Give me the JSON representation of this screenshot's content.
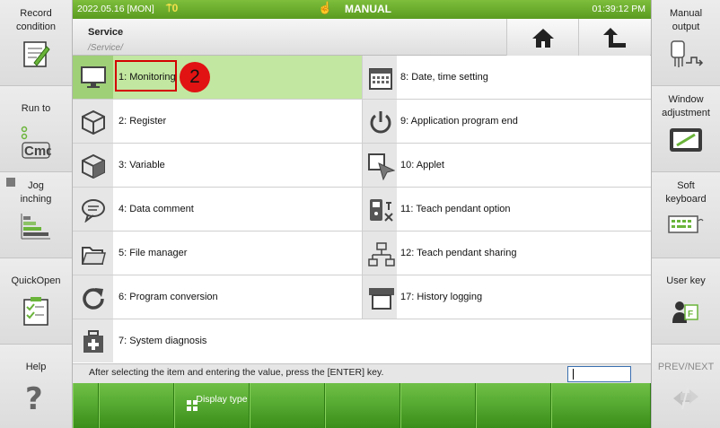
{
  "topbar": {
    "date": "2022.05.16 [MON]",
    "signal": "0",
    "mode": "MANUAL",
    "time": "01:39:12 PM"
  },
  "header": {
    "title": "Service",
    "path": "/Service/"
  },
  "left_panel": [
    {
      "name": "record-condition",
      "label": "Record condition",
      "icon": "notepad-pencil-icon"
    },
    {
      "name": "run-to",
      "label": "Run to",
      "icon": "cmd-icon"
    },
    {
      "name": "jog-inching",
      "label": "Jog inching",
      "icon": "jog-bars-icon"
    },
    {
      "name": "quickopen",
      "label": "QuickOpen",
      "icon": "checklist-icon"
    },
    {
      "name": "help",
      "label": "Help",
      "icon": "question-icon"
    }
  ],
  "right_panel": [
    {
      "name": "manual-output",
      "label": "Manual output",
      "icon": "hand-output-icon"
    },
    {
      "name": "window-adjustment",
      "label": "Window adjustment",
      "icon": "window-resize-icon"
    },
    {
      "name": "soft-keyboard",
      "label": "Soft keyboard",
      "icon": "keyboard-icon"
    },
    {
      "name": "user-key",
      "label": "User key",
      "icon": "user-key-icon"
    },
    {
      "name": "prev-next",
      "label": "PREV/NEXT",
      "icon": "prev-next-icon"
    }
  ],
  "menu_left": [
    {
      "label": "1: Monitoring",
      "icon": "monitor-icon",
      "selected": true
    },
    {
      "label": "2: Register",
      "icon": "cube-icon"
    },
    {
      "label": "3: Variable",
      "icon": "cube-icon"
    },
    {
      "label": "4: Data comment",
      "icon": "speech-bubble-icon"
    },
    {
      "label": "5: File manager",
      "icon": "folder-icon"
    },
    {
      "label": "6: Program conversion",
      "icon": "refresh-icon"
    },
    {
      "label": "7: System diagnosis",
      "icon": "medkit-icon"
    }
  ],
  "menu_right": [
    {
      "label": "8: Date, time setting",
      "icon": "calendar-icon"
    },
    {
      "label": "9: Application program end",
      "icon": "power-icon"
    },
    {
      "label": "10: Applet",
      "icon": "applet-cursor-icon"
    },
    {
      "label": "11: Teach pendant option",
      "icon": "pendant-tools-icon"
    },
    {
      "label": "12: Teach pendant sharing",
      "icon": "network-icon"
    },
    {
      "label": "17: History logging",
      "icon": "printer-log-icon"
    }
  ],
  "annotation_badge": "2",
  "status": {
    "message": "After selecting the item and entering the value, press the [ENTER] key.",
    "input_value": ""
  },
  "function_keys": [
    "",
    "",
    "Display type",
    "",
    "",
    "",
    "",
    ""
  ]
}
